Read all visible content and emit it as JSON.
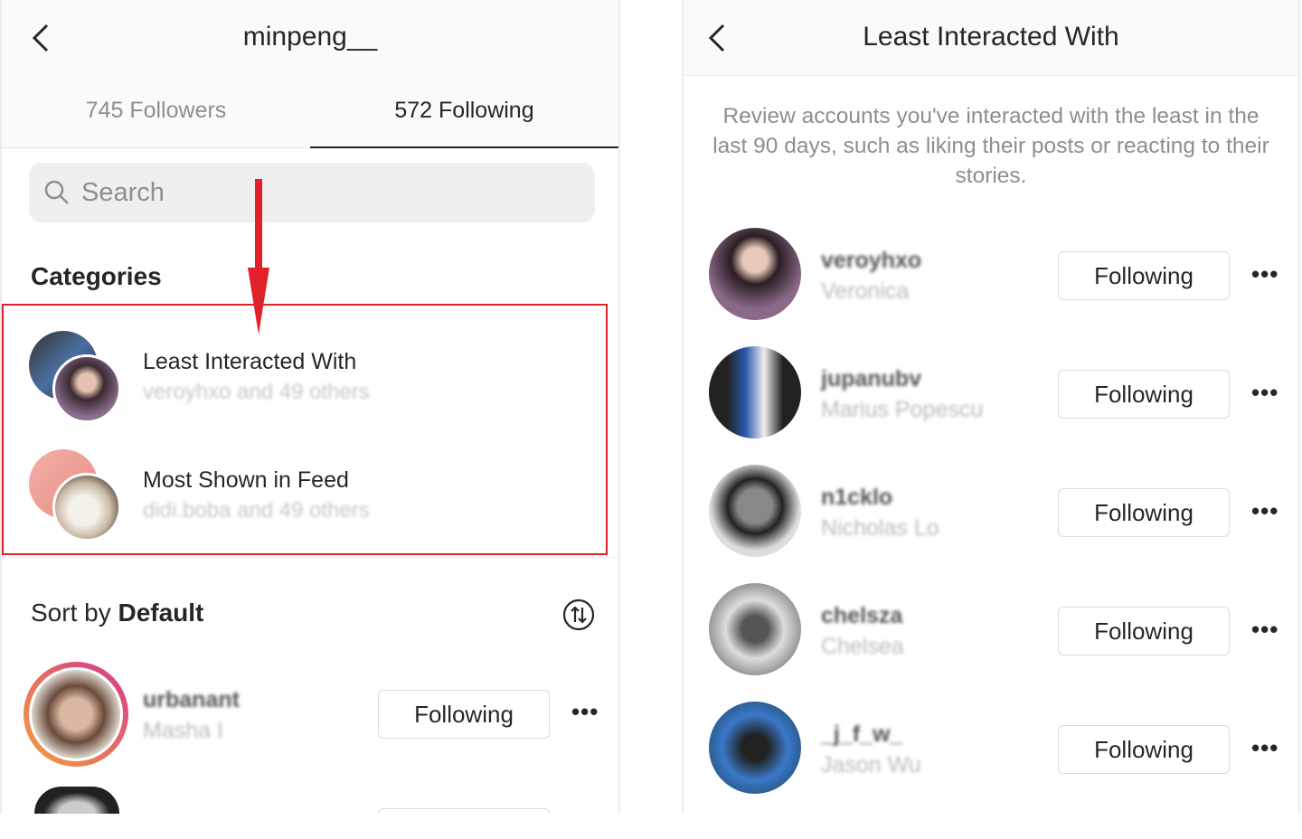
{
  "left": {
    "title": "minpeng__",
    "tabs": [
      {
        "label": "745 Followers",
        "active": false
      },
      {
        "label": "572 Following",
        "active": true
      }
    ],
    "search_placeholder": "Search",
    "categories_heading": "Categories",
    "categories": [
      {
        "title": "Least Interacted With",
        "subtitle": "veroyhxo and 49 others"
      },
      {
        "title": "Most Shown in Feed",
        "subtitle": "didi.boba and 49 others"
      }
    ],
    "sort_prefix": "Sort by ",
    "sort_value": "Default",
    "accounts": [
      {
        "username": "urbanant",
        "name": "Masha I",
        "button": "Following"
      }
    ],
    "annotation_color": "#e0202a"
  },
  "right": {
    "title": "Least Interacted With",
    "description": "Review accounts you've interacted with the least in the last 90 days, such as liking their posts or reacting to their stories.",
    "accounts": [
      {
        "username": "veroyhxo",
        "name": "Veronica",
        "button": "Following"
      },
      {
        "username": "jupanubv",
        "name": "Marius Popescu",
        "button": "Following"
      },
      {
        "username": "n1cklo",
        "name": "Nicholas Lo",
        "button": "Following"
      },
      {
        "username": "chelsza",
        "name": "Chelsea",
        "button": "Following"
      },
      {
        "username": "_j_f_w_",
        "name": "Jason Wu",
        "button": "Following"
      }
    ]
  },
  "icons": {
    "back": "chevron-left-icon",
    "search": "search-icon",
    "sort": "sort-arrows-icon",
    "more": "more-horizontal-icon"
  }
}
